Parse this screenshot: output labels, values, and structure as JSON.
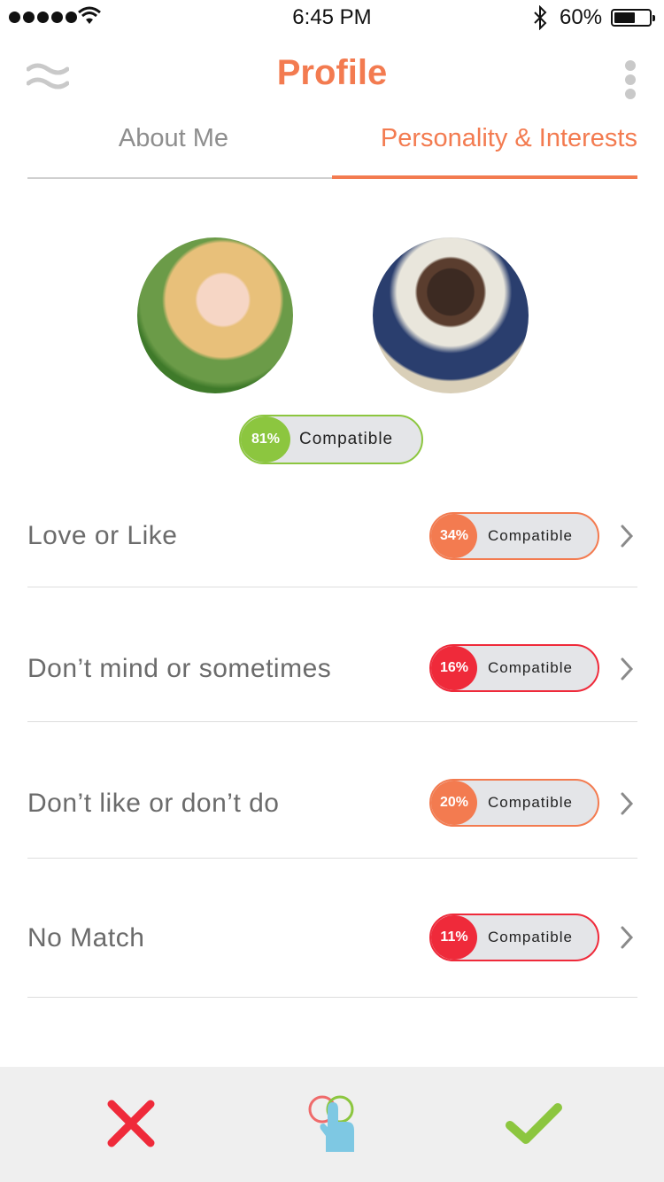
{
  "status_bar": {
    "time": "6:45 PM",
    "battery_percent": "60%",
    "battery_level": 0.6,
    "signal_bars": 5
  },
  "header": {
    "title": "Profile",
    "menu_icon": "waves-menu-icon",
    "more_icon": "vertical-dots-icon"
  },
  "tabs": [
    {
      "label": "About Me",
      "active": false
    },
    {
      "label": "Personality & Interests",
      "active": true
    }
  ],
  "overall": {
    "percent": "81%",
    "label": "Compatible",
    "color": "#8cc63f"
  },
  "categories": [
    {
      "label": "Love or Like",
      "percent": "34%",
      "compat_label": "Compatible",
      "color": "#f37b50"
    },
    {
      "label": "Don’t mind or sometimes",
      "percent": "16%",
      "compat_label": "Compatible",
      "color": "#ef2a3a"
    },
    {
      "label": "Don’t like or don’t do",
      "percent": "20%",
      "compat_label": "Compatible",
      "color": "#f37b50"
    },
    {
      "label": "No Match",
      "percent": "11%",
      "compat_label": "Compatible",
      "color": "#ef2a3a"
    }
  ],
  "colors": {
    "accent": "#f37b50",
    "green": "#8cc63f",
    "red": "#ef2a3a",
    "compare_blue": "#7ec8e3"
  },
  "bottom_actions": [
    {
      "name": "reject",
      "icon": "x-icon"
    },
    {
      "name": "compare",
      "icon": "touch-compare-icon"
    },
    {
      "name": "accept",
      "icon": "checkmark-icon"
    }
  ]
}
